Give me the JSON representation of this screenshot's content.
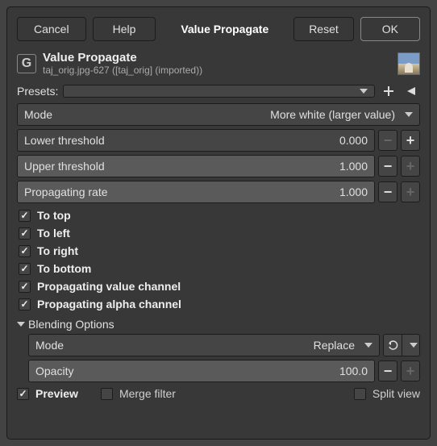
{
  "toolbar": {
    "cancel": "Cancel",
    "help": "Help",
    "title": "Value Propagate",
    "reset": "Reset",
    "ok": "OK"
  },
  "header": {
    "title": "Value Propagate",
    "subtitle": "taj_orig.jpg-627 ([taj_orig] (imported))"
  },
  "presets": {
    "label": "Presets:"
  },
  "mode": {
    "label": "Mode",
    "value": "More white (larger value)"
  },
  "sliders": {
    "lower": {
      "label": "Lower threshold",
      "value": "0.000"
    },
    "upper": {
      "label": "Upper threshold",
      "value": "1.000"
    },
    "rate": {
      "label": "Propagating rate",
      "value": "1.000"
    }
  },
  "checks": {
    "top": "To top",
    "left": "To left",
    "right": "To right",
    "bottom": "To bottom",
    "value_channel": "Propagating value channel",
    "alpha_channel": "Propagating alpha channel"
  },
  "blending": {
    "header": "Blending Options",
    "mode_label": "Mode",
    "mode_value": "Replace",
    "opacity_label": "Opacity",
    "opacity_value": "100.0"
  },
  "bottom": {
    "preview": "Preview",
    "merge_filter": "Merge filter",
    "split_view": "Split view"
  }
}
